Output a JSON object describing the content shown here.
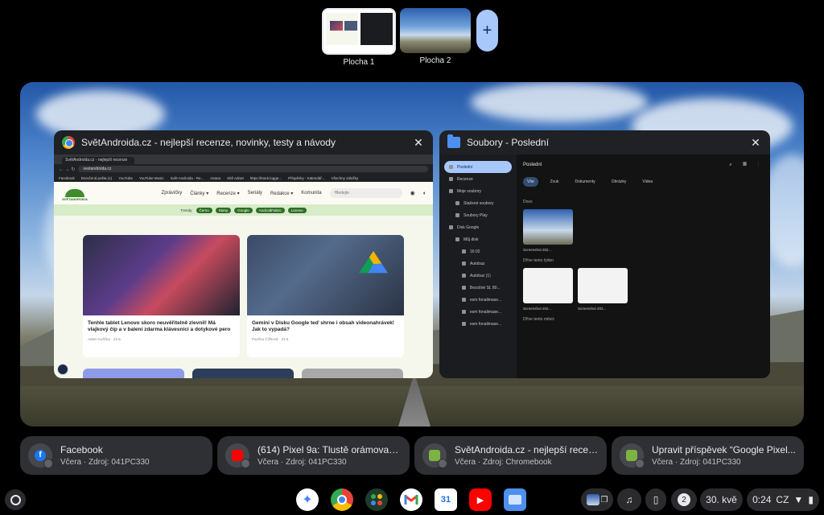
{
  "desks": [
    {
      "label": "Plocha 1"
    },
    {
      "label": "Plocha 2"
    }
  ],
  "add_desk_symbol": "+",
  "windows": {
    "browser": {
      "title": "SvětAndroida.cz - nejlepší recenze, novinky, testy a návody",
      "tab_label": "SvětAndroida.cz - nejlepší recenze",
      "url": "svetandroida.cz",
      "bookmarks": [
        "Facebook",
        "Doručená pošta (1)",
        "YouTube",
        "YouTube Music",
        "Svět Androida - Re...",
        "Asana",
        "Sítě Adnet",
        "https://track.logge...",
        "Příspěvky - Kalendář...",
        "Všechny záložky"
      ],
      "site": {
        "logo_text": "SVĚTANDROIDA",
        "nav": [
          "Zprávičky",
          "Články ▾",
          "Recenze ▾",
          "Seriály",
          "Redakce ▾",
          "Komunita"
        ],
        "search_placeholder": "Hledejte",
        "trends_label": "Trendy:",
        "trends": [
          "Černo",
          "Steny",
          "Google",
          "AndroidFabric",
          "Lenovo"
        ],
        "cards": [
          {
            "title": "Tenhle tablet Lenovo skoro neuvěřitelně zlevnil! Má vlajkový čip a v balení zdarma klávesnici a dotykové pero",
            "meta": "Adam Kuřička · 23.5."
          },
          {
            "title": "Gemini v Disku Google teď shrne i obsah videonahrávek! Jak to vypadá?",
            "meta": "Pavlína Čížková · 23.5."
          }
        ]
      }
    },
    "files": {
      "title": "Soubory - Poslední",
      "sidebar": [
        "Poslední",
        "Recenze",
        "Moje soubory",
        "Stažené soubory",
        "Soubory Play",
        "Disk Google",
        "Můj disk",
        "16:02",
        "Autobaz",
        "Autobaz (1)",
        "Bezcitné SL 80...",
        "esm fonalimase...",
        "esm fonalimase...",
        "esm fonalimase..."
      ],
      "heading": "Poslední",
      "filters": [
        "Vše",
        "Zvuk",
        "Dokumenty",
        "Obrázky",
        "Videa"
      ],
      "sections": [
        {
          "label": "Dnes",
          "files": [
            "Screenshot 202..."
          ]
        },
        {
          "label": "Dříve tento týden",
          "files": [
            "Screenshot 202...",
            "Screenshot 202..."
          ]
        },
        {
          "label": "Dříve tento měsíc",
          "files": []
        }
      ]
    }
  },
  "notifications": [
    {
      "title": "Facebook",
      "subtitle": "Včera · Zdroj: 041PC330",
      "app_icon": "facebook-icon"
    },
    {
      "title": "(614) Pixel 9a: Tlustě orámovaná...",
      "subtitle": "Včera · Zdroj: 041PC330",
      "app_icon": "youtube-icon"
    },
    {
      "title": "SvětAndroida.cz - nejlepší recen...",
      "subtitle": "Včera · Zdroj: Chromebook",
      "app_icon": "svetandroida-icon"
    },
    {
      "title": "Upravit příspěvek “Google Pixel...",
      "subtitle": "Včera · Zdroj: 041PC330",
      "app_icon": "svetandroida-icon"
    }
  ],
  "shelf": {
    "apps": [
      "gemini-icon",
      "chrome-icon",
      "app-launcher-grid-icon",
      "gmail-icon",
      "calendar-icon",
      "youtube-icon",
      "files-icon"
    ],
    "calendar_day": "31",
    "notification_count": "2",
    "date": "30. kvě",
    "time": "0:24",
    "ime": "CZ"
  },
  "colors": {
    "accent": "#a8c7fa",
    "window_bg": "#202124",
    "chip_bg": "#2f3033"
  }
}
